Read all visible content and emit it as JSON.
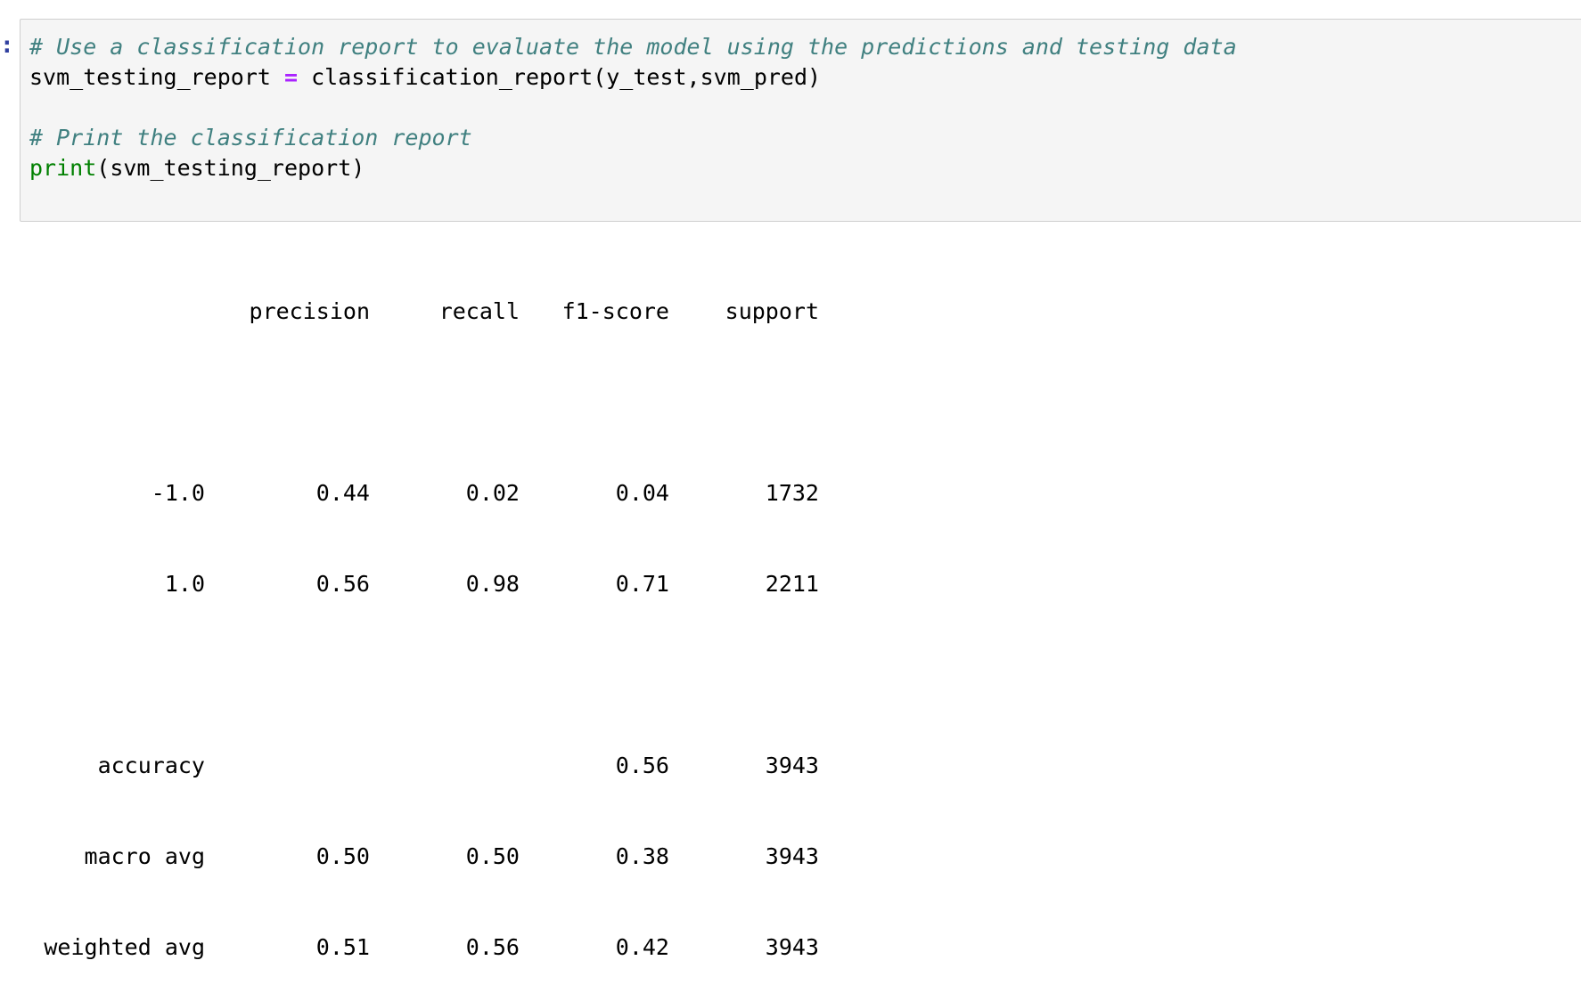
{
  "cell": {
    "prompt_suffix": ":",
    "code_lines": [
      {
        "kind": "comment",
        "text": "# Use a classification report to evaluate the model using the predictions and testing data"
      },
      {
        "kind": "assign",
        "var": "svm_testing_report",
        "op": "=",
        "rest": "classification_report(y_test,svm_pred)"
      },
      {
        "kind": "blank",
        "text": ""
      },
      {
        "kind": "comment",
        "text": "# Print the classification report"
      },
      {
        "kind": "call",
        "builtin": "print",
        "rest": "(svm_testing_report)"
      }
    ]
  },
  "report": {
    "headers": [
      "precision",
      "recall",
      "f1-score",
      "support"
    ],
    "rows": [
      {
        "label": "-1.0",
        "precision": "0.44",
        "recall": "0.02",
        "f1": "0.04",
        "support": "1732"
      },
      {
        "label": "1.0",
        "precision": "0.56",
        "recall": "0.98",
        "f1": "0.71",
        "support": "2211"
      },
      {
        "label": "accuracy",
        "precision": "",
        "recall": "",
        "f1": "0.56",
        "support": "3943"
      },
      {
        "label": "macro avg",
        "precision": "0.50",
        "recall": "0.50",
        "f1": "0.38",
        "support": "3943"
      },
      {
        "label": "weighted avg",
        "precision": "0.51",
        "recall": "0.56",
        "f1": "0.42",
        "support": "3943"
      }
    ]
  },
  "colors": {
    "comment": "#408080",
    "operator": "#aa22ff",
    "builtin": "#008000",
    "prompt": "#303f9f",
    "cell_background": "#f5f5f5",
    "cell_border": "#cfcfcf"
  }
}
